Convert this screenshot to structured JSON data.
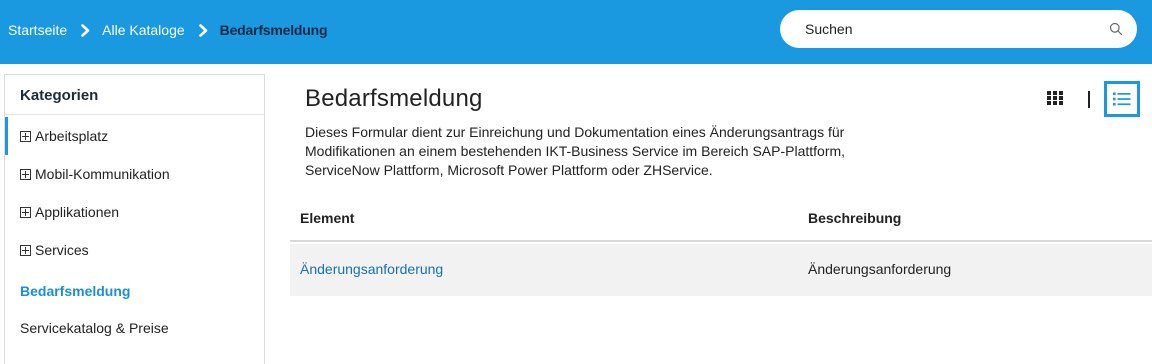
{
  "breadcrumb": {
    "items": [
      "Startseite",
      "Alle Kataloge"
    ],
    "current": "Bedarfsmeldung"
  },
  "search": {
    "placeholder": "Suchen",
    "value": ""
  },
  "sidebar": {
    "title": "Kategorien",
    "items": [
      {
        "label": "Arbeitsplatz",
        "expandable": true
      },
      {
        "label": "Mobil-Kommunikation",
        "expandable": true
      },
      {
        "label": "Applikationen",
        "expandable": true
      },
      {
        "label": "Services",
        "expandable": true
      },
      {
        "label": "Bedarfsmeldung",
        "expandable": false,
        "selected": true
      },
      {
        "label": "Servicekatalog & Preise",
        "expandable": false
      }
    ]
  },
  "main": {
    "title": "Bedarfsmeldung",
    "description": "Dieses Formular dient zur Einreichung und Dokumentation eines Änderungsantrags für Modifikationen an einem bestehenden IKT-Business Service im Bereich SAP-Plattform, ServiceNow Plattform, Microsoft Power Plattform oder ZHService.",
    "table": {
      "columns": [
        "Element",
        "Beschreibung"
      ],
      "rows": [
        {
          "element": "Änderungsanforderung",
          "beschreibung": "Änderungsanforderung"
        }
      ]
    }
  },
  "icons": {
    "breadcrumb_separator": "chevron-right-icon",
    "search": "search-icon",
    "grid_view": "grid-view-icon",
    "list_view": "list-view-icon"
  },
  "colors": {
    "topbar": "#1a98e0",
    "accent": "#1a98e0",
    "link": "#1a6fad",
    "breadcrumb_current": "#0b2a45"
  }
}
